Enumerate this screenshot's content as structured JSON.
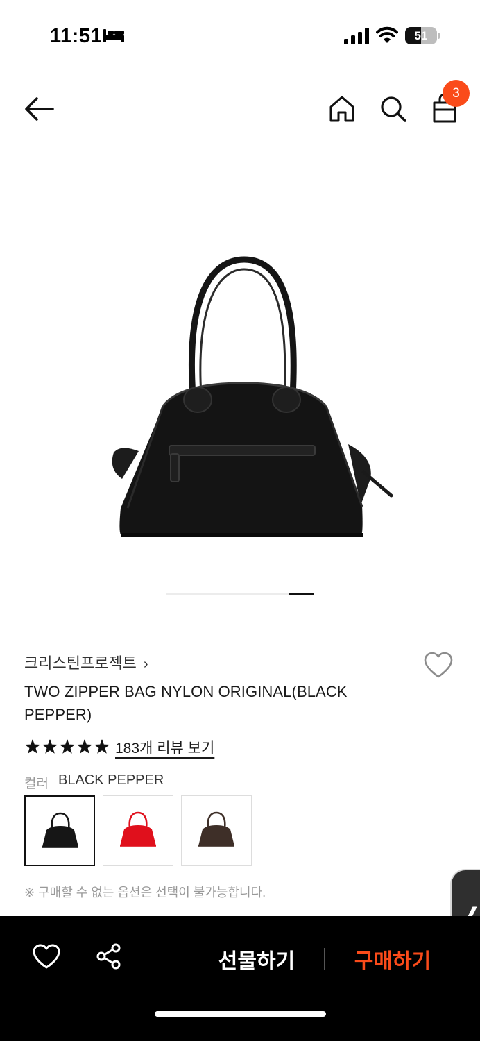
{
  "status_bar": {
    "time": "11:51",
    "battery_level": "51",
    "icons": [
      "bed-icon",
      "cellular-signal-icon",
      "wifi-icon",
      "battery-icon"
    ]
  },
  "nav": {
    "icons": [
      "back-arrow-icon",
      "home-icon",
      "search-icon",
      "shopping-bag-icon"
    ],
    "cart_count": "3",
    "badge_color": "#fa4b1a"
  },
  "carousel": {
    "active_index": 2,
    "total": 2
  },
  "product": {
    "brand": "크리스틴프로젝트",
    "brand_chevron": "›",
    "title": "TWO ZIPPER BAG NYLON ORIGINAL(BLACK PEPPER)",
    "rating_stars": 5,
    "review_link": "183개 리뷰 보기",
    "color_label": "컬러",
    "color_value": "BLACK PEPPER",
    "color_options": [
      {
        "swatch": "#161616",
        "selected": true
      },
      {
        "swatch": "#e0101c",
        "selected": false
      },
      {
        "swatch": "#3e2f28",
        "selected": false
      }
    ],
    "option_note": "※ 구매할 수 없는 옵션은 선택이 불가능합니다."
  },
  "side_handle": {
    "glyph": "❬"
  },
  "bottom_bar": {
    "gift_label": "선물하기",
    "buy_label": "구매하기",
    "buy_color": "#fa4b1a",
    "icons": [
      "heart-icon",
      "share-icon"
    ]
  }
}
